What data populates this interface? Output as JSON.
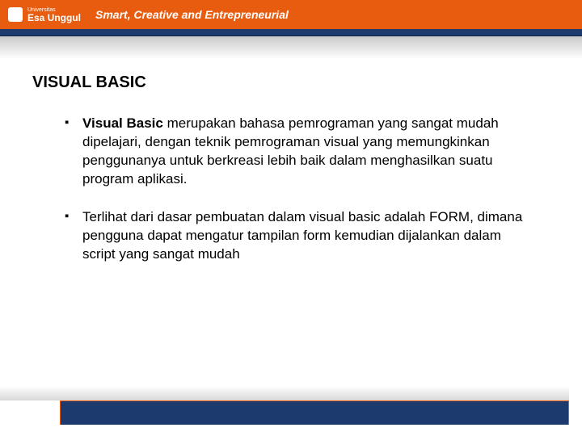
{
  "header": {
    "university_prefix": "Universitas",
    "university_name": "Esa Unggul",
    "tagline": "Smart, Creative and Entrepreneurial"
  },
  "slide": {
    "title": "VISUAL BASIC",
    "bullets": [
      {
        "bold_lead": "Visual Basic",
        "rest": " merupakan bahasa pemrograman yang sangat mudah dipelajari, dengan teknik pemrograman visual yang memungkinkan penggunanya untuk berkreasi lebih baik dalam menghasilkan suatu program aplikasi."
      },
      {
        "bold_lead": "",
        "rest": "Terlihat dari dasar pembuatan dalam visual basic adalah FORM, dimana pengguna dapat mengatur tampilan form kemudian dijalankan dalam script yang sangat mudah"
      }
    ]
  }
}
